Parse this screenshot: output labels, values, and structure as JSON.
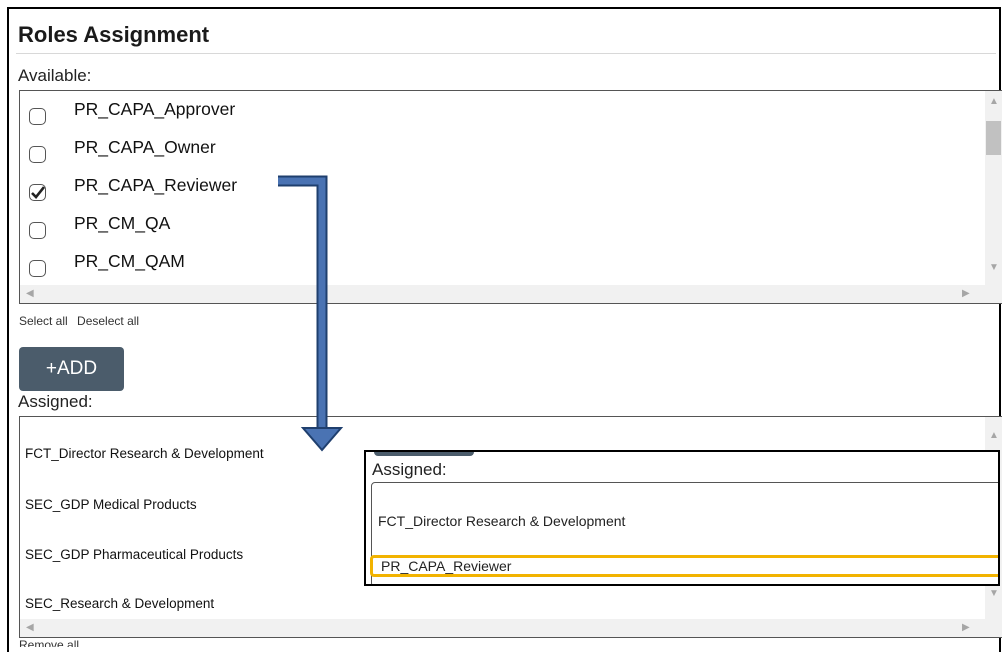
{
  "section": {
    "title": "Roles Assignment"
  },
  "available": {
    "label": "Available:",
    "items": [
      {
        "label": "PR_CAPA_Approver",
        "checked": false
      },
      {
        "label": "PR_CAPA_Owner",
        "checked": false
      },
      {
        "label": "PR_CAPA_Reviewer",
        "checked": true
      },
      {
        "label": "PR_CM_QA",
        "checked": false
      },
      {
        "label": "PR_CM_QAM",
        "checked": false
      }
    ],
    "select_all": "Select all",
    "deselect_all": "Deselect all"
  },
  "add_button": {
    "label": "+ADD"
  },
  "assigned": {
    "label": "Assigned:",
    "items": [
      "FCT_Director Research & Development",
      "SEC_GDP Medical Products",
      "SEC_GDP Pharmaceutical Products",
      "SEC_Research & Development"
    ],
    "remove_all": "Remove all"
  },
  "zoom_callout": {
    "label": "Assigned:",
    "items": [
      "FCT_Director Research & Development",
      "PR_CAPA_Reviewer"
    ],
    "highlight_color": "#f2b300"
  },
  "colors": {
    "button_bg": "#4b5c6b",
    "arrow": "#4a73b3"
  }
}
